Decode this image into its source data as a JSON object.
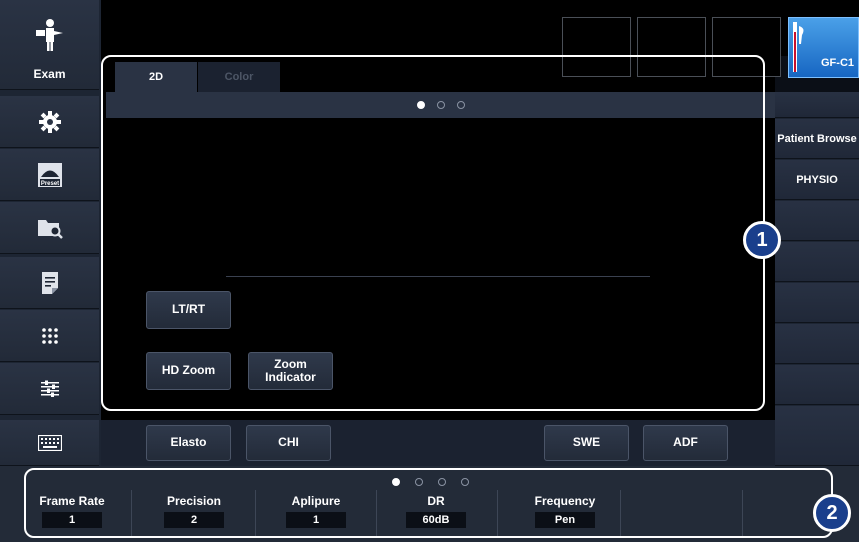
{
  "left_toolbar": {
    "exam_label": "Exam",
    "items": [
      {
        "name": "exam-person-icon"
      },
      {
        "name": "gear-icon"
      },
      {
        "name": "preset-icon",
        "text": "Preset"
      },
      {
        "name": "folder-search-icon"
      },
      {
        "name": "report-icon"
      },
      {
        "name": "grid-dots-icon"
      },
      {
        "name": "sliders-icon"
      },
      {
        "name": "keyboard-icon"
      }
    ]
  },
  "probe": {
    "label": "GF-C1"
  },
  "tabs": [
    {
      "label": "2D",
      "active": true
    },
    {
      "label": "Color",
      "active": false
    }
  ],
  "page_dots": {
    "count": 3,
    "current": 1
  },
  "panel_buttons": {
    "lt_rt": "LT/RT",
    "hd_zoom": "HD Zoom",
    "zoom_indicator_1": "Zoom",
    "zoom_indicator_2": "Indicator"
  },
  "bottom_buttons": {
    "elasto": "Elasto",
    "chi": "CHI",
    "swe": "SWE",
    "adf": "ADF"
  },
  "right_panel": {
    "items": [
      "Patient Browse",
      "PHYSIO",
      "",
      "",
      "",
      "",
      "",
      ""
    ]
  },
  "params_dots": {
    "count": 4,
    "current": 1
  },
  "params": [
    {
      "label": "Frame Rate",
      "value": "1"
    },
    {
      "label": "Precision",
      "value": "2"
    },
    {
      "label": "Aplipure",
      "value": "1"
    },
    {
      "label": "DR",
      "value": "60dB"
    },
    {
      "label": "Frequency",
      "value": "Pen"
    }
  ],
  "callouts": [
    "1",
    "2"
  ],
  "colors": {
    "accent": "#1a3f8c",
    "probe": "#1766c2",
    "panel": "#2a3344"
  }
}
